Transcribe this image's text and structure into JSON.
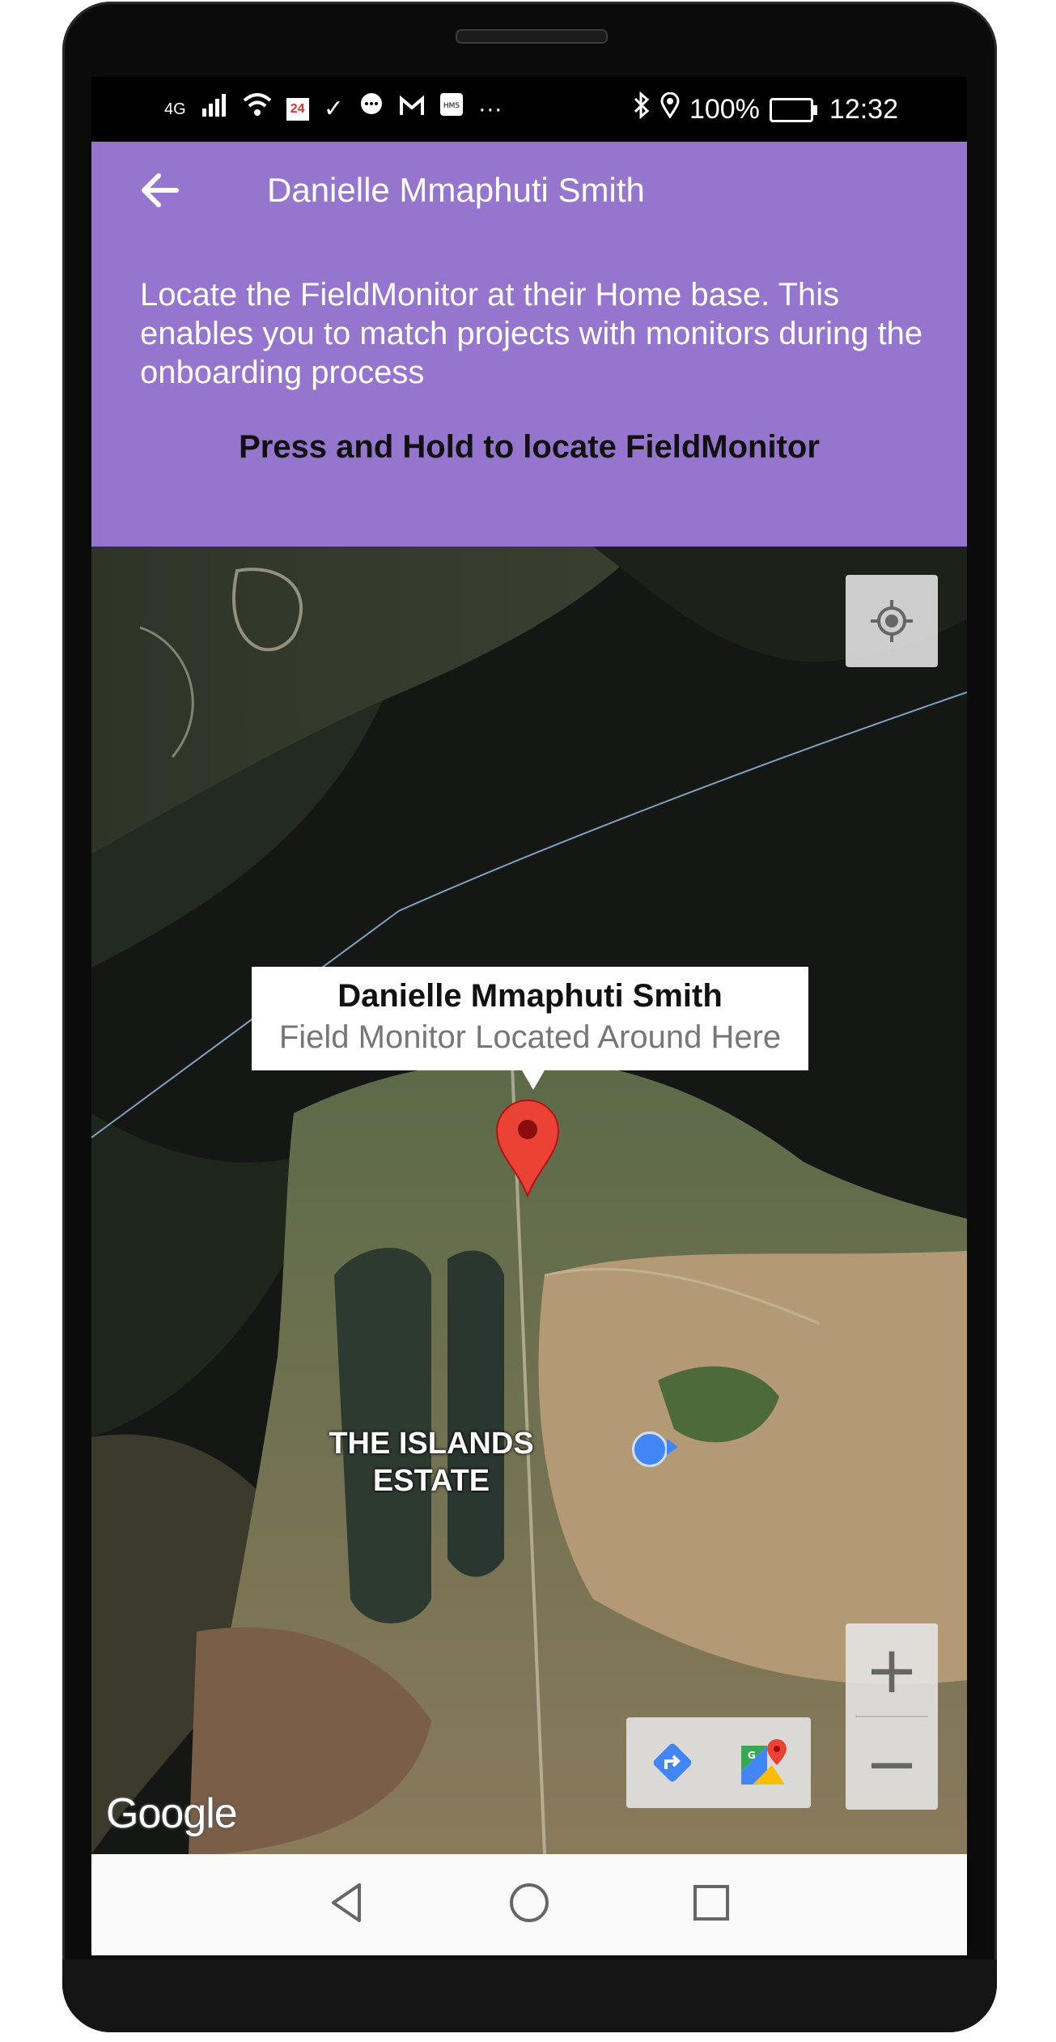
{
  "status_bar": {
    "network": "4G",
    "news_badge": "24",
    "battery": "100%",
    "time": "12:32",
    "icons": [
      "signal-icon",
      "wifi-icon",
      "news-icon",
      "check-icon",
      "chat-icon",
      "gmail-icon",
      "hms-icon",
      "more-icon",
      "bluetooth-icon",
      "location-icon",
      "battery-icon"
    ]
  },
  "appbar": {
    "title": "Danielle Mmaphuti Smith",
    "description": "Locate the FieldMonitor at their Home base. This enables you to match projects with monitors during the onboarding process",
    "instruction": "Press and Hold to locate FieldMonitor",
    "background": "#9575cd"
  },
  "map": {
    "info_window": {
      "title": "Danielle Mmaphuti Smith",
      "snippet": "Field Monitor Located Around Here"
    },
    "place_label": "THE ISLANDS ESTATE",
    "attribution": "Google",
    "controls": {
      "my_location": "my-location-icon",
      "zoom_in": "+",
      "zoom_out": "−",
      "directions": "directions-icon",
      "open_maps": "google-maps-icon"
    },
    "marker_color": "#ea4335"
  },
  "navbar": {
    "back": "back-triangle-icon",
    "home": "home-circle-icon",
    "recents": "recents-square-icon"
  }
}
